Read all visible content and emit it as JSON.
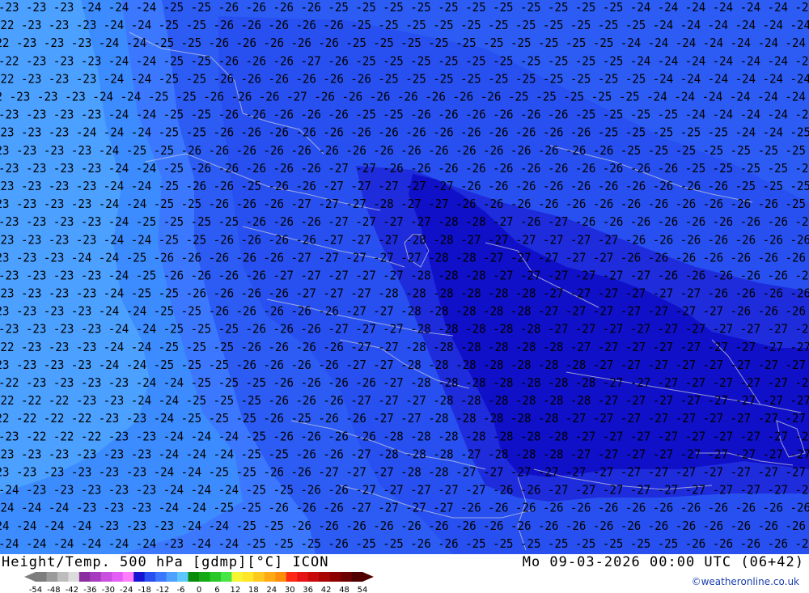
{
  "header": {
    "title": "Height/Temp. 500 hPa [gdmp][°C] ICON",
    "datetime": "Mo 09-03-2026 00:00 UTC (06+42)",
    "credit": "©weatheronline.co.uk"
  },
  "legend": {
    "ticks": [
      "-54",
      "-48",
      "-42",
      "-36",
      "-30",
      "-24",
      "-18",
      "-12",
      "-6",
      "0",
      "6",
      "12",
      "18",
      "24",
      "30",
      "36",
      "42",
      "48",
      "54"
    ],
    "colors": [
      "#7d7d7d",
      "#9b9b9b",
      "#bdbdbd",
      "#dcdcdc",
      "#8b2fa0",
      "#a83cc0",
      "#c84fe0",
      "#e35ff5",
      "#ff7dff",
      "#1414d2",
      "#2850f0",
      "#3c78ff",
      "#4ca0ff",
      "#5cc8ff",
      "#0a8c0a",
      "#14aa14",
      "#28c828",
      "#46e646",
      "#f5f532",
      "#ffe628",
      "#ffc81e",
      "#ffaa14",
      "#ff8c0a",
      "#ff2814",
      "#e61414",
      "#c80a0a",
      "#aa0505",
      "#8c0000",
      "#6e0000",
      "#500000"
    ]
  },
  "map_colors": {
    "minus22": "#4ca0ff",
    "minus23": "#3c8cff",
    "minus24": "#3c78ff",
    "minus25": "#2c5cf4",
    "minus26": "#2850f0",
    "minus27": "#1e2cdc",
    "minus28": "#1010c8",
    "contour_label": "#000000",
    "border_line": "#c8c8dc"
  },
  "contour_rows": [
    "-23 -23 -23 -24 -24 -24 -25 -25 -26 -26 -26 -26 -25 -25 -25 -25 -25 -25 -25 -25 -25 -25 -25 -24 -24 -24 -24 -24 -24 -24",
    "-22 -23 -23 -23 -24 -24 -25 -25 -26 -26 -26 -26 -26 -25 -25 -25 -25 -25 -25 -25 -25 -25 -25 -25 -24 -24 -24 -24 -24 -24",
    "-22 -23 -23 -23 -24 -24 -25 -25 -26 -26 -26 -26 -26 -25 -25 -25 -25 -25 -25 -25 -25 -25 -25 -24 -24 -24 -24 -24 -24 -24",
    "-22 -23 -23 -23 -24 -24 -25 -25 -26 -26 -26 -27 -26 -25 -25 -25 -25 -25 -25 -25 -25 -25 -25 -24 -24 -24 -24 -24 -24 -24",
    "-22 -23 -23 -23 -24 -24 -25 -25 -26 -26 -26 -26 -26 -26 -25 -25 -25 -25 -25 -25 -25 -25 -25 -25 -24 -24 -24 -24 -24 -24",
    "-2 -23 -23 -23 -24 -24 -25 -25 -26 -26 -26 -27 -26 -26 -26 -26 -26 -26 -26 -25 -25 -25 -25 -25 -24 -24 -24 -24 -24 -24",
    "-23 -23 -23 -23 -24 -24 -25 -25 -26 -26 -26 -26 -26 -25 -25 -26 -26 -26 -26 -26 -26 -25 -25 -25 -25 -24 -24 -24 -24 -25",
    "-23 -23 -23 -24 -24 -24 -25 -25 -26 -26 -26 -26 -26 -26 -26 -26 -26 -26 -26 -26 -26 -26 -25 -25 -25 -25 -25 -24 -24 -25",
    "-23 -23 -23 -23 -24 -25 -25 -26 -26 -26 -26 -26 -26 -26 -26 -26 -26 -26 -26 -26 -26 -26 -26 -25 -25 -25 -25 -25 -25 -25",
    "-23 -23 -23 -23 -24 -24 -25 -26 -26 -26 -26 -26 -27 -27 -26 -26 -26 -26 -26 -26 -26 -26 -26 -26 -26 -25 -25 -25 -25 -25",
    "-23 -23 -23 -23 -24 -24 -25 -26 -26 -25 -26 -26 -27 -27 -27 -27 -27 -26 -26 -26 -26 -26 -26 -26 -26 -26 -26 -25 -25 -25",
    "-23 -23 -23 -23 -24 -24 -25 -25 -26 -26 -26 -27 -27 -27 -28 -27 -27 -26 -26 -26 -26 -26 -26 -26 -26 -26 -26 -26 -26 -25",
    "-23 -23 -23 -23 -24 -25 -25 -25 -25 -26 -26 -26 -27 -27 -27 -27 -28 -28 -27 -26 -27 -26 -26 -26 -26 -26 -26 -26 -26 -26",
    "-23 -23 -23 -23 -24 -24 -25 -25 -26 -26 -26 -26 -27 -27 -27 -28 -28 -27 -27 -27 -27 -27 -27 -26 -26 -26 -26 -26 -26 -26",
    "-23 -23 -23 -24 -24 -25 -26 -26 -26 -26 -26 -27 -27 -27 -27 -27 -28 -28 -27 -27 -27 -27 -27 -26 -26 -26 -26 -26 -26 -26",
    "-23 -23 -23 -23 -24 -25 -26 -26 -26 -26 -27 -27 -27 -27 -27 -28 -28 -28 -27 -27 -27 -27 -27 -27 -26 -26 -26 -26 -26 -26",
    "-23 -23 -23 -23 -24 -25 -25 -26 -26 -26 -26 -27 -27 -27 -28 -28 -28 -28 -28 -28 -27 -27 -27 -27 -27 -27 -26 -26 -26 -26",
    "-23 -23 -23 -23 -24 -24 -25 -25 -26 -26 -26 -26 -26 -27 -27 -28 -28 -28 -28 -28 -27 -27 -27 -27 -27 -27 -27 -26 -26 -26",
    "-23 -23 -23 -23 -24 -24 -25 -25 -25 -26 -26 -26 -27 -27 -27 -28 -28 -28 -28 -28 -27 -27 -27 -27 -27 -27 -27 -27 -27 -27",
    "-22 -23 -23 -23 -24 -24 -25 -25 -25 -26 -26 -26 -26 -27 -27 -28 -28 -28 -28 -28 -28 -27 -27 -27 -27 -27 -27 -27 -27 -27",
    "-23 -23 -23 -23 -24 -24 -25 -25 -25 -26 -26 -26 -26 -27 -27 -28 -28 -28 -28 -28 -28 -28 -27 -27 -27 -27 -27 -27 -27 -27",
    "-22 -23 -23 -23 -23 -24 -24 -25 -25 -25 -26 -26 -26 -26 -27 -28 -28 -28 -28 -28 -28 -28 -27 -27 -27 -27 -27 -27 -27 -27",
    "-22 -22 -22 -23 -23 -24 -24 -25 -25 -25 -26 -26 -26 -27 -27 -27 -28 -28 -28 -28 -28 -28 -27 -27 -27 -27 -27 -27 -27 -27",
    "-22 -22 -22 -22 -23 -23 -24 -25 -25 -25 -26 -25 -26 -26 -27 -27 -28 -28 -28 -28 -28 -27 -27 -27 -27 -27 -27 -27 -27 -27",
    "-23 -22 -22 -22 -23 -23 -24 -24 -24 -25 -26 -26 -26 -26 -28 -28 -28 -28 -28 -28 -28 -27 -27 -27 -27 -27 -27 -27 -27 -27",
    "-23 -23 -23 -23 -23 -23 -24 -24 -24 -25 -25 -26 -26 -27 -28 -28 -28 -27 -28 -28 -28 -27 -27 -27 -27 -27 -27 -27 -27 -27",
    "-23 -23 -23 -23 -23 -23 -24 -24 -25 -25 -26 -26 -27 -27 -27 -28 -28 -27 -27 -27 -27 -27 -27 -27 -27 -27 -27 -27 -27 -27",
    "-24 -23 -23 -23 -23 -23 -24 -24 -24 -25 -25 -26 -26 -27 -27 -27 -27 -27 -26 -26 -27 -27 -27 -27 -27 -27 -27 -27 -27 -27",
    "-24 -24 -24 -23 -23 -23 -24 -24 -25 -25 -26 -26 -26 -27 -27 -27 -27 -26 -26 -26 -26 -26 -26 -26 -26 -26 -26 -26 -26 -26",
    "-24 -24 -24 -24 -23 -23 -23 -24 -24 -25 -25 -26 -26 -26 -26 -26 -26 -26 -26 -26 -26 -26 -26 -26 -26 -26 -26 -26 -26 -26",
    "-24 -24 -24 -24 -24 -24 -23 -24 -24 -25 -25 -25 -26 -25 -25 -26 -26 -25 -25 -25 -25 -25 -25 -25 -25 -26 -26 -26 -26 -26"
  ]
}
